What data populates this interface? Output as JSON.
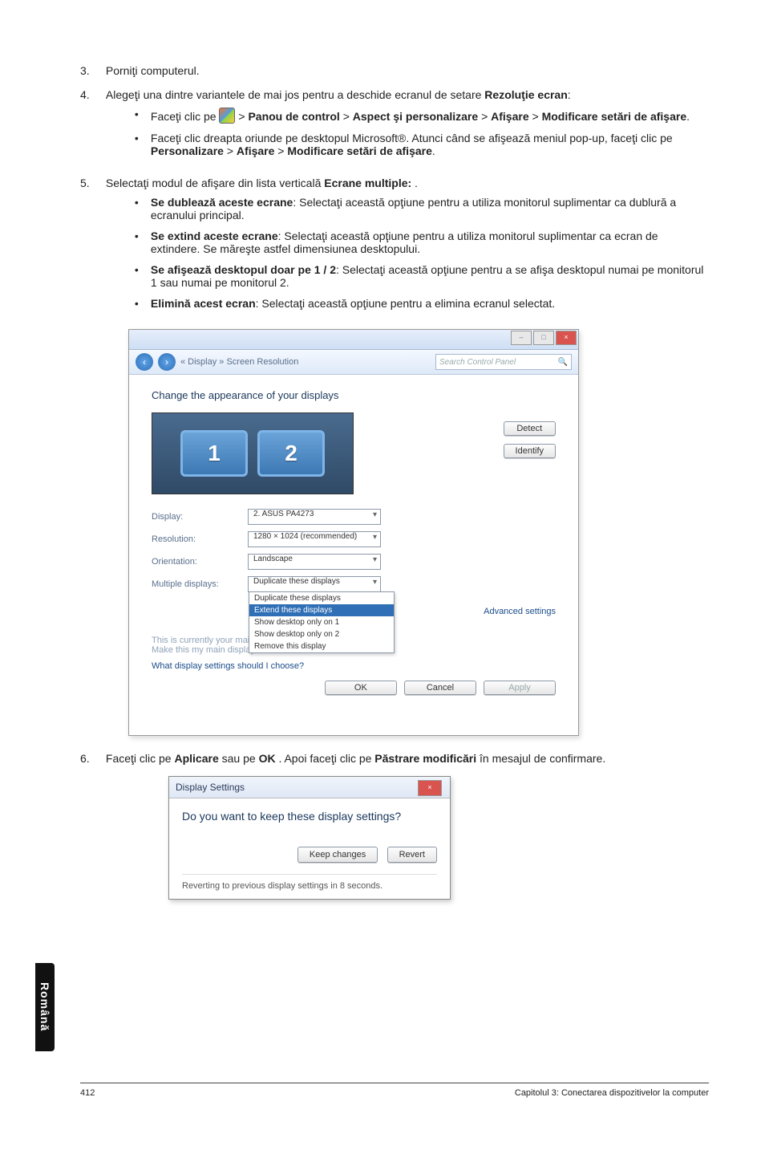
{
  "steps": {
    "s3": {
      "num": "3.",
      "text": "Porniţi computerul."
    },
    "s4": {
      "num": "4.",
      "text_pre": "Alegeţi una dintre variantele de mai jos pentru a deschide ecranul de setare ",
      "bold1": "Rezoluţie ecran",
      "text_post": ":",
      "a": {
        "lead": "Faceţi clic pe ",
        "gt1": " > ",
        "b1": "Panou de control",
        "gt2": " > ",
        "b2": "Aspect şi personalizare",
        "gt3": " > ",
        "b3": "Afişare",
        "gt4": " > ",
        "b4": "Modificare setări de afişare",
        "dot": "."
      },
      "b": {
        "t1": "Faceţi clic dreapta oriunde pe desktopul Microsoft®. Atunci când se afişează meniul pop-up, faceţi clic pe ",
        "b1": "Personalizare",
        "gt1": " > ",
        "b2": "Afişare",
        "gt2": " > ",
        "b3": "Modificare setări de afişare",
        "dot": "."
      }
    },
    "s5": {
      "num": "5.",
      "t1": "Selectaţi modul de afişare din lista verticală ",
      "b1": "Ecrane multiple:",
      "t2": " .",
      "items": {
        "dup": {
          "b": "Se dublează aceste ecrane",
          "t": ": Selectaţi această opţiune pentru a utiliza monitorul suplimentar ca dublură a ecranului principal."
        },
        "ext": {
          "b": "Se extind aceste ecrane",
          "t": ": Selectaţi această opţiune pentru a utiliza monitorul suplimentar ca ecran de extindere. Se măreşte astfel dimensiunea desktopului."
        },
        "show": {
          "b": "Se afişează desktopul doar pe 1 / 2",
          "t": ": Selectaţi această opţiune pentru a se afişa desktopul numai pe monitorul 1 sau numai pe monitorul 2."
        },
        "rem": {
          "b": "Elimină acest ecran",
          "t": ": Selectaţi această opţiune pentru a elimina ecranul selectat."
        }
      }
    },
    "s6": {
      "num": "6.",
      "t1": "Faceţi clic pe ",
      "b1": "Aplicare",
      "t2": " sau pe ",
      "b2": "OK",
      "t3": ". Apoi faceţi clic pe ",
      "b3": "Păstrare modificări",
      "t4": " în mesajul de confirmare."
    }
  },
  "win": {
    "crumb": "« Display » Screen Resolution",
    "search_placeholder": "Search Control Panel",
    "heading": "Change the appearance of your displays",
    "mon1": "1",
    "mon2": "2",
    "detect": "Detect",
    "identify": "Identify",
    "rows": {
      "display": {
        "lbl": "Display:",
        "val": "2. ASUS PA4273"
      },
      "resolution": {
        "lbl": "Resolution:",
        "val": "1280 × 1024 (recommended)"
      },
      "orientation": {
        "lbl": "Orientation:",
        "val": "Landscape"
      },
      "multiple": {
        "lbl": "Multiple displays:",
        "val": "Duplicate these displays"
      }
    },
    "dd": {
      "o1": "Duplicate these displays",
      "o2": "Extend these displays",
      "o3": "Show desktop only on 1",
      "o4": "Show desktop only on 2",
      "o5": "Remove this display"
    },
    "current_main": "This is currently your main display.",
    "make_main": "Make this my main display",
    "links": "What display settings should I choose?",
    "advanced": "Advanced settings",
    "ok": "OK",
    "cancel": "Cancel",
    "apply": "Apply"
  },
  "dlg": {
    "title": "Display Settings",
    "q": "Do you want to keep these display settings?",
    "keep": "Keep changes",
    "revert": "Revert",
    "timer": "Reverting to previous display settings in 8 seconds."
  },
  "sidetab": "Română",
  "footer": {
    "page": "412",
    "chapter": "Capitolul 3: Conectarea dispozitivelor la computer"
  }
}
